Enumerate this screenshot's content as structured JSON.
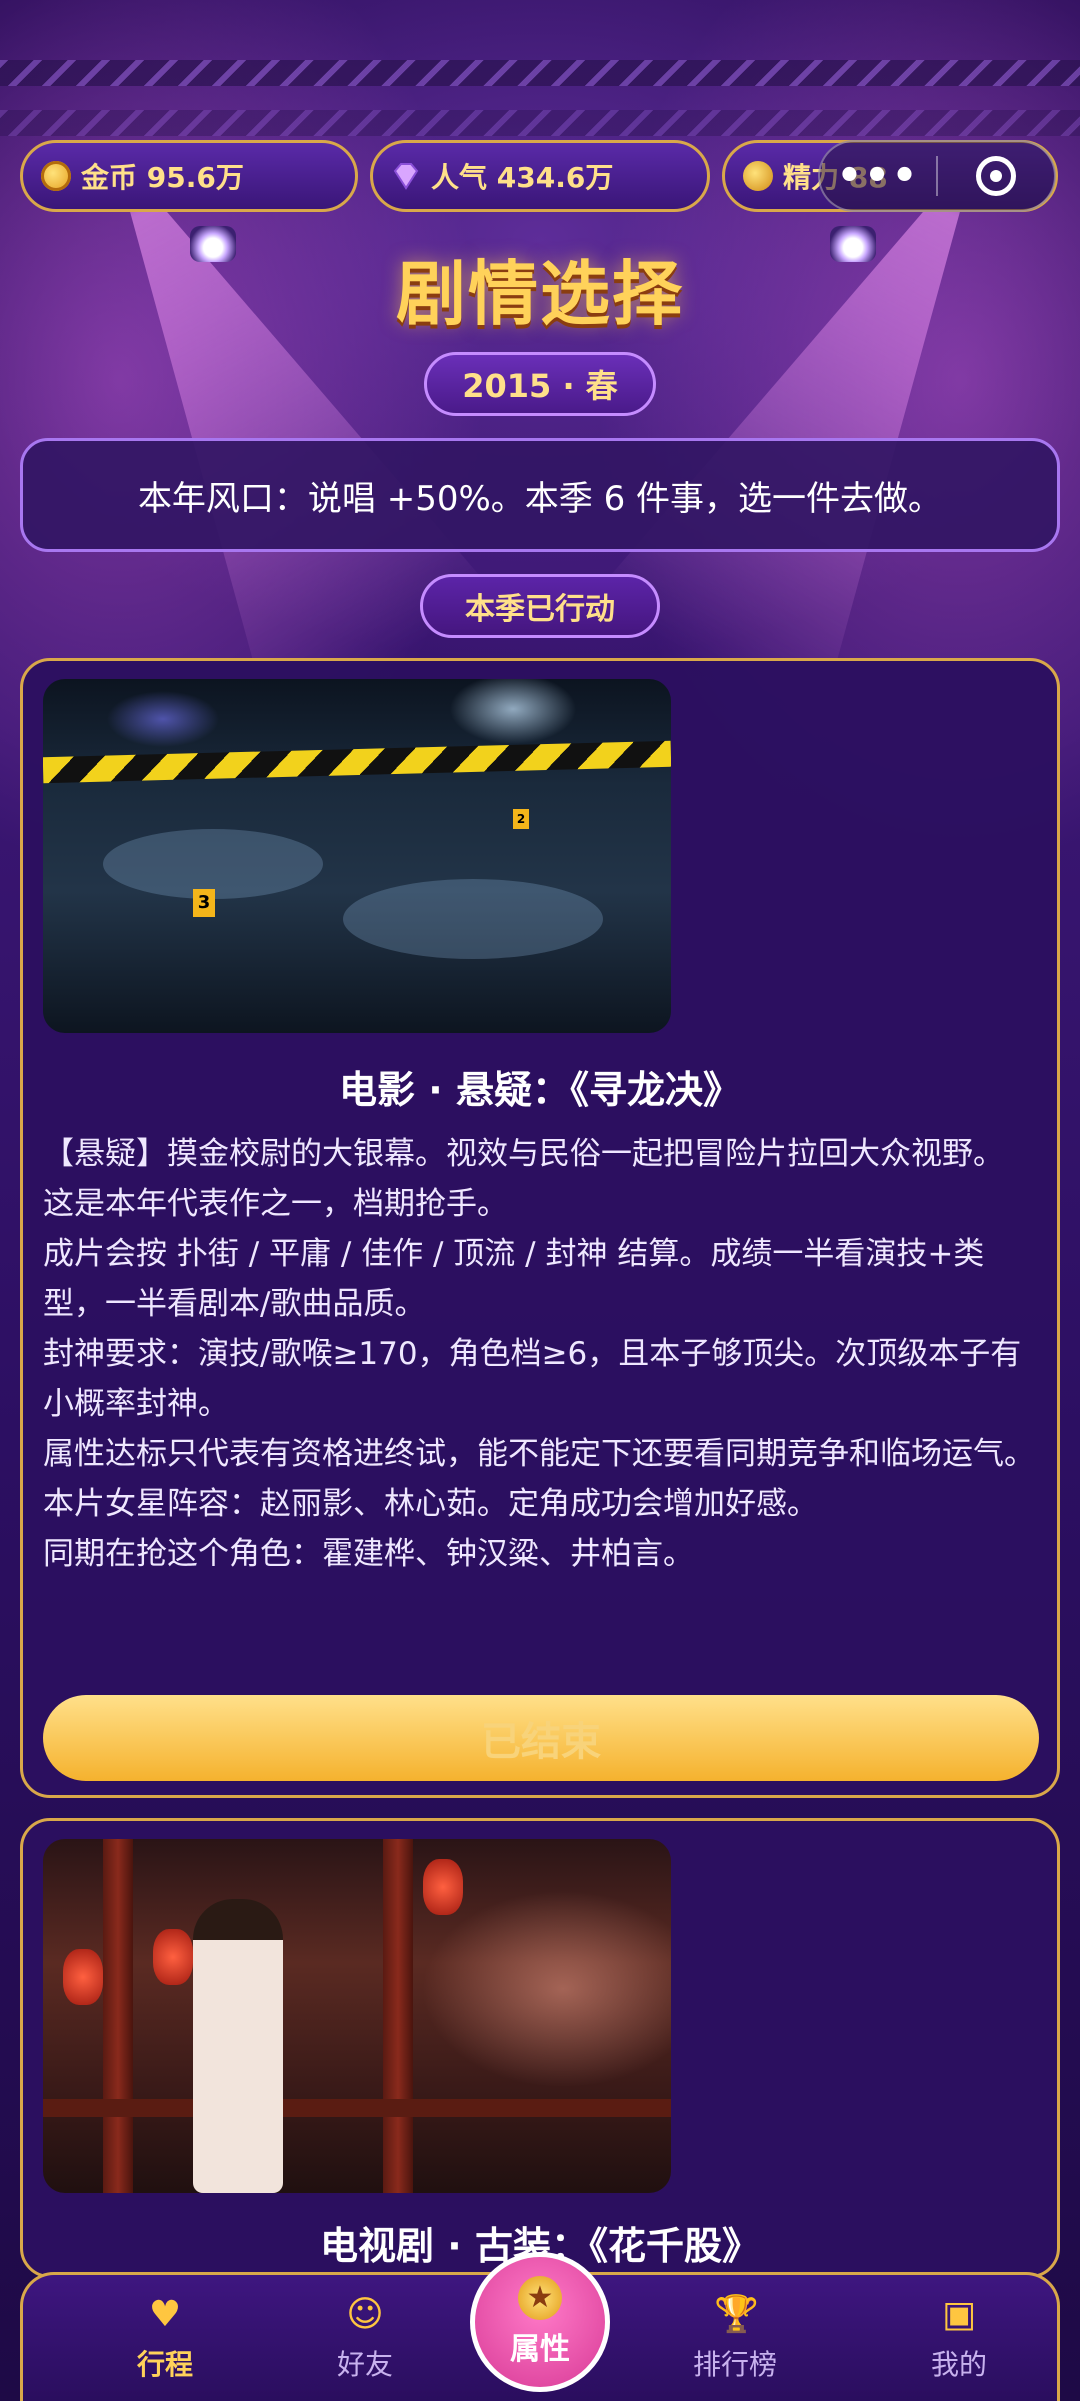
{
  "header": {
    "coins": "金币 95.6万",
    "popularity": "人气 434.6万",
    "energy": "精力 88"
  },
  "page": {
    "title": "剧情选择",
    "season": "2015 · 春",
    "notice": "本年风口：说唱 +50%。本季 6 件事，选一件去做。",
    "status_badge": "本季已行动"
  },
  "cards": [
    {
      "title": "电影 · 悬疑：《寻龙决》",
      "lines": [
        "【悬疑】摸金校尉的大银幕。视效与民俗一起把冒险片拉回大众视野。",
        "这是本年代表作之一，档期抢手。",
        "成片会按 扑街 / 平庸 / 佳作 / 顶流 / 封神 结算。成绩一半看演技+类型，一半看剧本/歌曲品质。",
        "封神要求：演技/歌喉≥170，角色档≥6，且本子够顶尖。次顶级本子有小概率封神。",
        "属性达标只代表有资格进终试，能不能定下还要看同期竞争和临场运气。",
        "本片女星阵容：赵丽影、林心茹。定角成功会增加好感。",
        "同期在抢这个角色：霍建桦、钟汉粱、井柏言。"
      ],
      "button": "已结束"
    },
    {
      "title": "电视剧 · 古装：《花千股》"
    }
  ],
  "nav": {
    "items": [
      "行程",
      "好友",
      "属性",
      "排行榜",
      "我的"
    ]
  },
  "colors": {
    "accent": "#ffd25a",
    "border": "#d9a84a",
    "center": "#d83a96"
  }
}
